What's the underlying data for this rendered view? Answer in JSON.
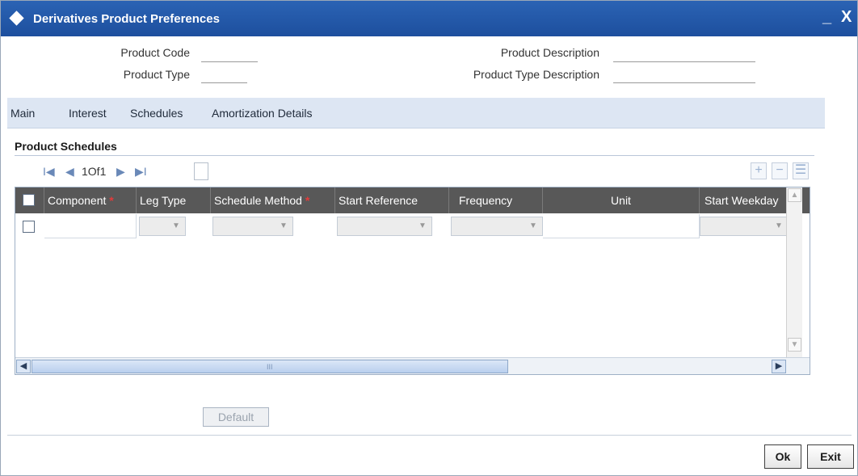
{
  "window": {
    "title": "Derivatives Product Preferences",
    "minimize_label": "_",
    "close_label": "X"
  },
  "header": {
    "product_code_label": "Product Code",
    "product_type_label": "Product Type",
    "product_description_label": "Product Description",
    "product_type_description_label": "Product Type Description",
    "product_code_value": "",
    "product_type_value": "",
    "product_description_value": "",
    "product_type_description_value": ""
  },
  "tabs": [
    {
      "label": "Main"
    },
    {
      "label": "Interest"
    },
    {
      "label": "Schedules"
    },
    {
      "label": "Amortization Details"
    }
  ],
  "section": {
    "title": "Product Schedules"
  },
  "pager": {
    "first": "I◀",
    "prev": "◀",
    "page_text": "1Of1",
    "next": "▶",
    "last": "▶I"
  },
  "toolbar": {
    "add": "+",
    "remove": "−",
    "view": "☰"
  },
  "grid": {
    "columns": [
      {
        "label": "Component",
        "required": true
      },
      {
        "label": "Leg Type",
        "required": false
      },
      {
        "label": "Schedule Method",
        "required": true
      },
      {
        "label": "Start Reference",
        "required": false
      },
      {
        "label": "Frequency",
        "required": false
      },
      {
        "label": "Unit",
        "required": false
      },
      {
        "label": "Start Weekday",
        "required": false
      }
    ],
    "required_marker": "*",
    "rows": [
      {
        "component": "",
        "leg_type": "",
        "schedule_method": "",
        "start_reference": "",
        "frequency": "",
        "unit": "",
        "start_weekday": ""
      }
    ],
    "scroll_grip": "III"
  },
  "buttons": {
    "default": "Default",
    "ok": "Ok",
    "exit": "Exit"
  }
}
